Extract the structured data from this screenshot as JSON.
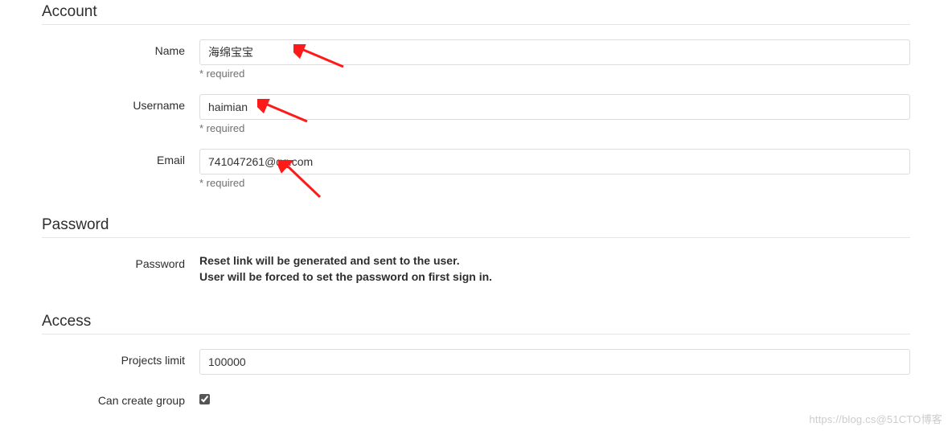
{
  "sections": {
    "account": {
      "title": "Account",
      "fields": {
        "name": {
          "label": "Name",
          "value": "海绵宝宝",
          "help": "* required"
        },
        "username": {
          "label": "Username",
          "value": "haimian",
          "help": "* required"
        },
        "email": {
          "label": "Email",
          "value": "741047261@qq.com",
          "help": "* required"
        }
      }
    },
    "password": {
      "title": "Password",
      "label": "Password",
      "note_line1": "Reset link will be generated and sent to the user.",
      "note_line2": "User will be forced to set the password on first sign in."
    },
    "access": {
      "title": "Access",
      "fields": {
        "projects_limit": {
          "label": "Projects limit",
          "value": "100000"
        },
        "can_create_group": {
          "label": "Can create group",
          "checked": true
        }
      }
    }
  },
  "watermark": "https://blog.cs@51CTO博客"
}
